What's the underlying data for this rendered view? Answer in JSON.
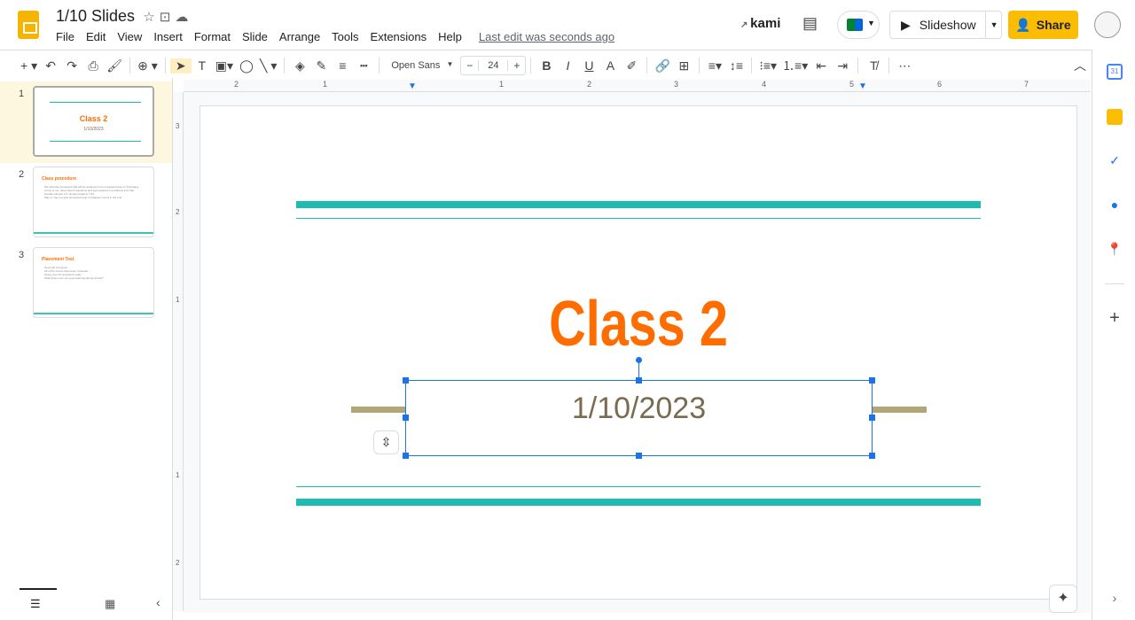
{
  "app": {
    "title": "1/10 Slides",
    "last_edit": "Last edit was seconds ago"
  },
  "menu": [
    "File",
    "Edit",
    "View",
    "Insert",
    "Format",
    "Slide",
    "Arrange",
    "Tools",
    "Extensions",
    "Help"
  ],
  "header": {
    "kami": "kami",
    "slideshow": "Slideshow",
    "share": "Share"
  },
  "toolbar": {
    "font": "Open Sans",
    "font_size": "24",
    "minus": "−",
    "plus": "+"
  },
  "slides": [
    {
      "num": "1",
      "title": "Class 2",
      "subtitle": "1/10/2023"
    },
    {
      "num": "2",
      "title": "Class procedure",
      "bullets": [
        "We will have homework that will be assigned to be completed due on Thursdays",
        "Come to me, raise hand if questions and type answers to problems into chat",
        "Usually will give a 5 minutes break at 7:30",
        "May or may not give homework help in breakout rooms in the end"
      ]
    },
    {
      "num": "3",
      "title": "Placement Test",
      "bullets": [
        "Good job everyone!",
        "All of the scores have been reviewed",
        "Going over the questions today",
        "What lesson are you guys learning during school?"
      ]
    }
  ],
  "ruler_top": [
    "2",
    "1",
    "1",
    "2",
    "3",
    "4",
    "5",
    "6",
    "7"
  ],
  "ruler_left": [
    "3",
    "2",
    "1",
    "1",
    "2"
  ],
  "slide": {
    "title": "Class 2",
    "date": "1/10/2023"
  },
  "colors": {
    "accent": "#ff6d00",
    "teal": "#1cbcb0",
    "selection": "#1a73e8",
    "share": "#fbbc04"
  }
}
